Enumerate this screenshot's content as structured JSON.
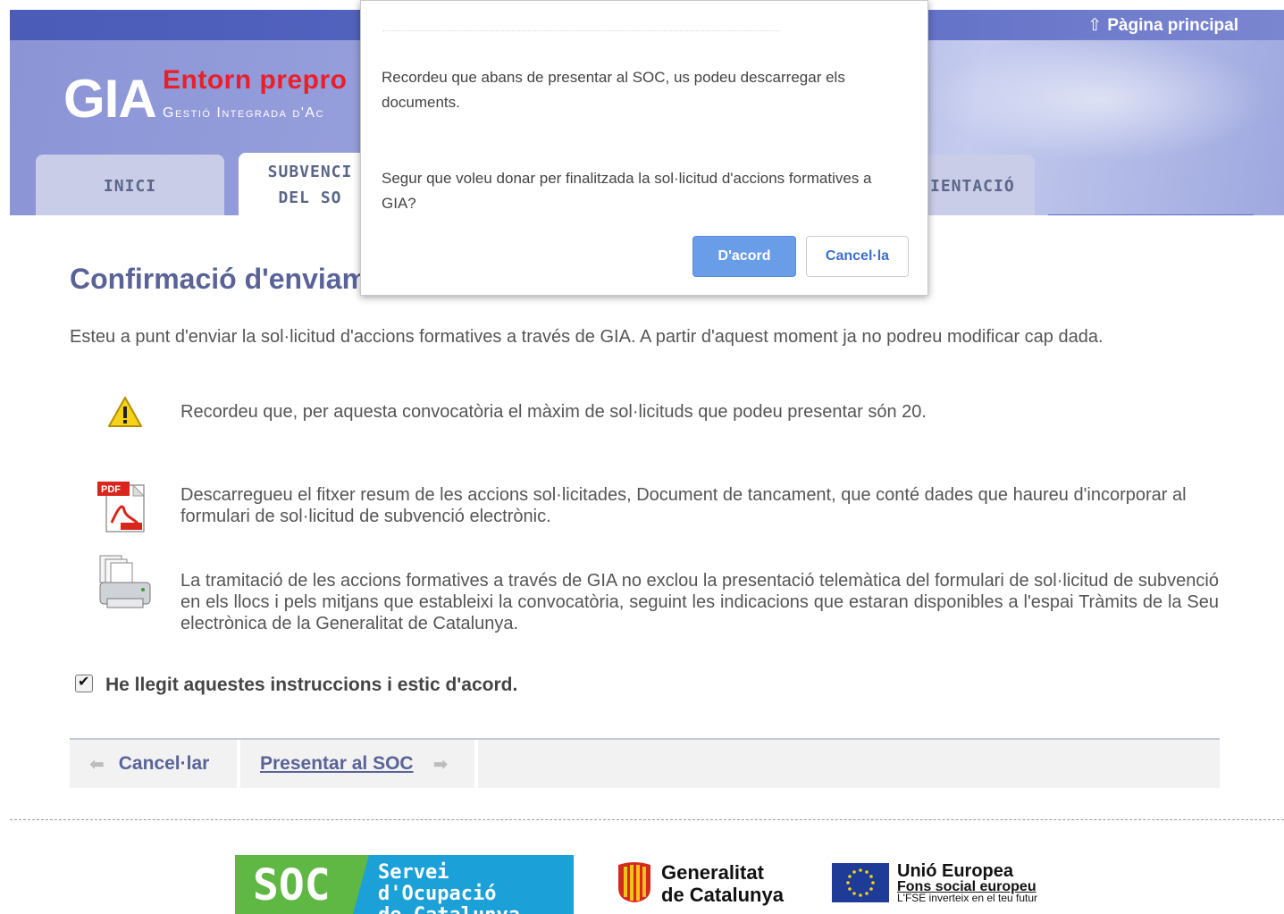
{
  "header": {
    "home_link": "Pàgina principal",
    "logo_main": "GIA",
    "logo_env": "Entorn prepro",
    "logo_sub": "Gestió Integrada d'Ac",
    "tabs": [
      {
        "label": "INICI"
      },
      {
        "label_line1": "SUBVENCI",
        "label_line2": "DEL SO"
      },
      {
        "label": "IENTACIÓ"
      }
    ]
  },
  "main": {
    "title": "Confirmació d'enviam",
    "intro": "Esteu a punt d'enviar la sol·licitud d'accions formatives a través de GIA. A partir d'aquest moment ja no podreu modificar cap dada.",
    "notices": [
      {
        "icon": "warning-icon",
        "text": "Recordeu que, per aquesta convocatòria el màxim de sol·licituds que podeu presentar són 20."
      },
      {
        "icon": "pdf-icon",
        "text": "Descarregueu el fitxer resum de les accions sol·licitades, Document de tancament, que conté dades que haureu d'incorporar al formulari de sol·licitud de subvenció electrònic."
      },
      {
        "icon": "printer-icon",
        "text": "La tramitació de les accions formatives a través de GIA no exclou la presentació telemàtica del formulari de sol·licitud de subvenció en els llocs i pels mitjans que estableixi la convocatòria, seguint les indicacions que estaran disponibles a l'espai Tràmits de la Seu electrònica de la Generalitat de Catalunya."
      }
    ],
    "agree_label": "He llegit aquestes instruccions i estic d'acord.",
    "agree_checked": true,
    "cancel_label": "Cancel·lar",
    "present_label": "Presentar al SOC"
  },
  "footer": {
    "soc_short": "SOC",
    "soc_line1": "Servei d'Ocupació",
    "soc_line2": "de Catalunya",
    "gen_line1": "Generalitat",
    "gen_line2": "de Catalunya",
    "ue_line1": "Unió Europea",
    "ue_line2": "Fons social europeu",
    "ue_line3": "L'FSE inverteix en el teu futur"
  },
  "dialog": {
    "message1": "Recordeu que abans de presentar al SOC, us podeu descarregar els documents.",
    "message2": "Segur que voleu donar per finalitzada la sol·licitud d'accions formatives a GIA?",
    "ok_label": "D'acord",
    "cancel_label": "Cancel·la"
  },
  "colors": {
    "accent": "#5a6398",
    "dialog_ok": "#6a9de8",
    "brand_red": "#e8202a"
  }
}
